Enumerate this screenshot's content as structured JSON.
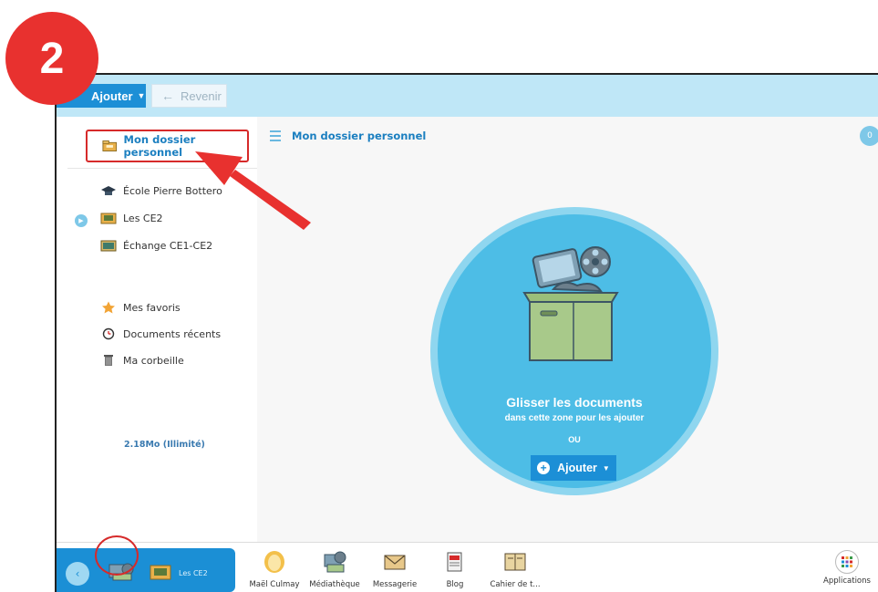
{
  "step_badge": "2",
  "toolbar": {
    "add_label": "Ajouter",
    "back_label": "Revenir"
  },
  "sidebar": {
    "my_folder": "Mon dossier personnel",
    "shared": [
      {
        "label": "École Pierre Bottero",
        "icon": "school-hat-icon"
      },
      {
        "label": "Les CE2",
        "icon": "class-folder-icon"
      },
      {
        "label": "Échange CE1-CE2",
        "icon": "exchange-folder-icon"
      }
    ],
    "utility": [
      {
        "label": "Mes favoris",
        "icon": "star-icon"
      },
      {
        "label": "Documents récents",
        "icon": "clock-icon"
      },
      {
        "label": "Ma corbeille",
        "icon": "trash-icon"
      }
    ],
    "quota": "2.18Mo (Illimité)"
  },
  "content": {
    "title": "Mon dossier personnel",
    "count": "0",
    "drop_title": "Glisser les documents",
    "drop_subtitle": "dans cette zone pour les ajouter",
    "or_label": "OU",
    "add_label": "Ajouter"
  },
  "dock": {
    "active_label": "Les CE2",
    "apps": [
      {
        "label": "Maël Culmay",
        "icon": "avatar-icon"
      },
      {
        "label": "Médiathèque",
        "icon": "media-library-icon"
      },
      {
        "label": "Messagerie",
        "icon": "envelope-icon"
      },
      {
        "label": "Blog",
        "icon": "blog-icon"
      },
      {
        "label": "Cahier de t...",
        "icon": "notebook-icon"
      }
    ],
    "applications_label": "Applications"
  },
  "colors": {
    "accent": "#1c8fd6",
    "topbar": "#bfe7f7",
    "highlight": "#d62a2a",
    "drop_zone": "#4dbde6"
  }
}
